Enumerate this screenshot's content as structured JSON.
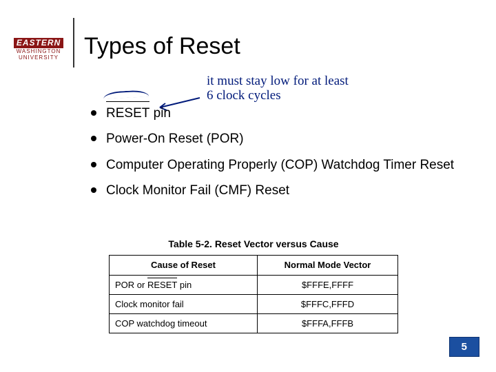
{
  "logo": {
    "top": "EASTERN",
    "mid": "WASHINGTON",
    "bot": "UNIVERSITY"
  },
  "title": "Types of Reset",
  "annotation": {
    "line1": "it must stay low for at least",
    "line2": "6 clock cycles"
  },
  "bullets": {
    "b0_word": "RESET",
    "b0_suffix": " pin",
    "b1": "Power-On Reset (POR)",
    "b2": "Computer Operating Properly (COP) Watchdog Timer Reset",
    "b3": "Clock Monitor Fail (CMF) Reset"
  },
  "table": {
    "caption": "Table 5-2. Reset Vector versus Cause",
    "head": {
      "c0": "Cause of Reset",
      "c1": "Normal Mode Vector"
    },
    "rows": {
      "r0": {
        "c0_prefix": "POR or ",
        "c0_over": "RESET",
        "c0_suffix": " pin",
        "c1": "$FFFE,FFFF"
      },
      "r1": {
        "c0": "Clock monitor fail",
        "c1": "$FFFC,FFFD"
      },
      "r2": {
        "c0": "COP watchdog timeout",
        "c1": "$FFFA,FFFB"
      }
    }
  },
  "slide_number": "5"
}
